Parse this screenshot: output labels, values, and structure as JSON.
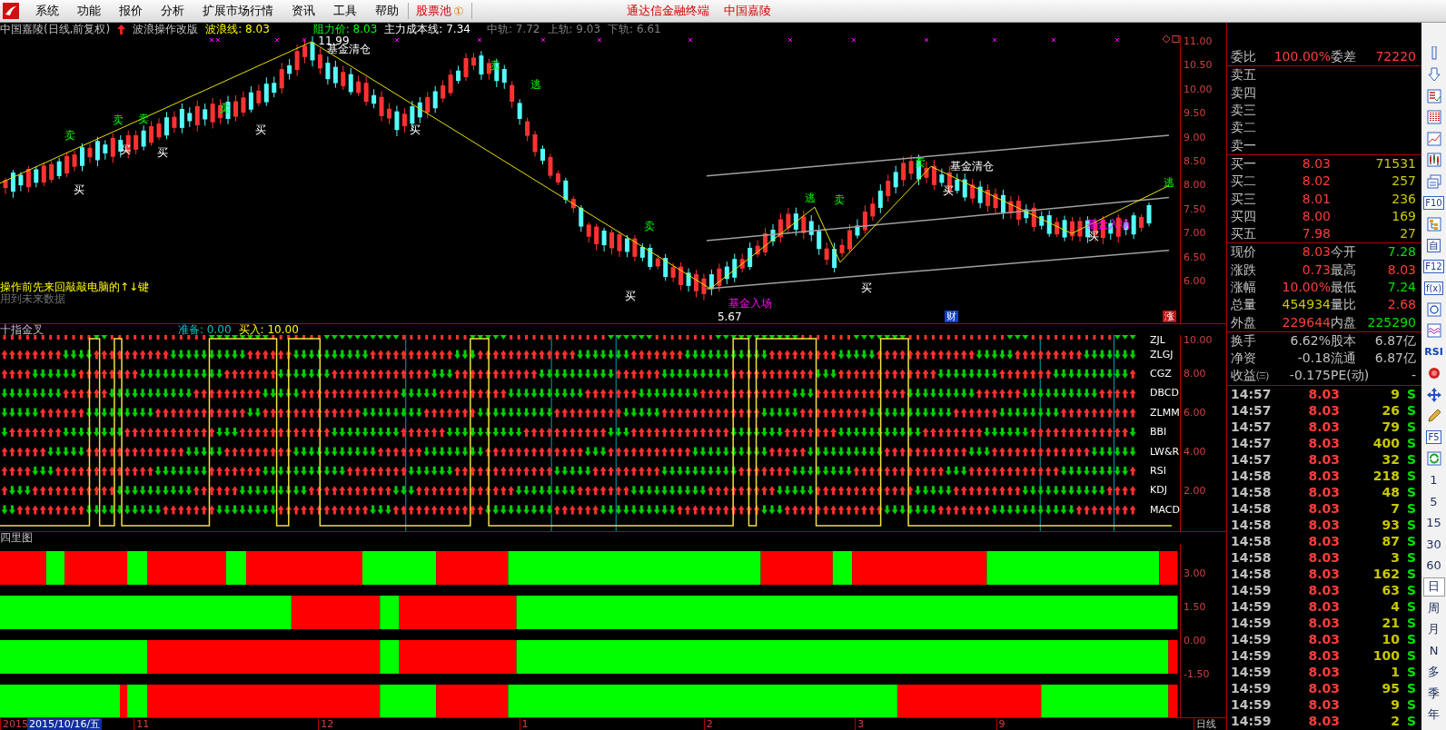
{
  "menu_bar": {
    "items": [
      "系统",
      "功能",
      "报价",
      "分析",
      "扩展市场行情",
      "资讯",
      "工具",
      "帮助"
    ],
    "pool": {
      "label": "股票池",
      "badge": "①"
    },
    "title": "通达信金融终端",
    "stock": "中国嘉陵"
  },
  "price_chart": {
    "title": "中国嘉陵(日线,前复权)",
    "indicator": "波浪操作改版",
    "readings": [
      {
        "kind": "wave",
        "text": "波浪线: 8.03"
      },
      {
        "kind": "resist",
        "text": "阻力价: 8.03"
      },
      {
        "kind": "cost",
        "text": "主力成本线: 7.34"
      },
      {
        "kind": "band",
        "text": "中轨: 7.72"
      },
      {
        "kind": "band",
        "text": "上轨: 9.03"
      },
      {
        "kind": "band",
        "text": "下轨: 6.61"
      }
    ],
    "axis": [
      "11.00",
      "10.50",
      "10.00",
      "9.50",
      "9.00",
      "8.50",
      "8.00",
      "7.50",
      "7.00",
      "6.50",
      "6.00"
    ],
    "signals": [
      {
        "kind": "buy",
        "text": "买"
      },
      {
        "kind": "sell",
        "text": "卖"
      },
      {
        "kind": "buy",
        "text": "买"
      },
      {
        "kind": "sell",
        "text": "卖"
      },
      {
        "kind": "sell",
        "text": "卖"
      },
      {
        "kind": "buy",
        "text": "买"
      },
      {
        "kind": "sell",
        "text": "卖"
      },
      {
        "kind": "buy",
        "text": "买"
      },
      {
        "kind": "price",
        "text": "11.99"
      },
      {
        "kind": "fund-out",
        "text": "基金清仓"
      },
      {
        "kind": "buy",
        "text": "买"
      },
      {
        "kind": "sell",
        "text": "卖"
      },
      {
        "kind": "escape",
        "text": "逃"
      },
      {
        "kind": "sell",
        "text": "卖"
      },
      {
        "kind": "buy",
        "text": "买"
      },
      {
        "kind": "fund-in",
        "text": "基金入场"
      },
      {
        "kind": "price",
        "text": "5.67"
      },
      {
        "kind": "escape",
        "text": "逃"
      },
      {
        "kind": "sell",
        "text": "卖"
      },
      {
        "kind": "buy",
        "text": "买"
      },
      {
        "kind": "sell",
        "text": "卖"
      },
      {
        "kind": "fund-out",
        "text": "基金清仓"
      },
      {
        "kind": "buy",
        "text": "买"
      },
      {
        "kind": "fund-in",
        "text": "基金入场"
      },
      {
        "kind": "buy",
        "text": "买"
      },
      {
        "kind": "escape",
        "text": "逃"
      }
    ],
    "notes": [
      {
        "kind": "hint",
        "text": "操作前先来回敲敲电脑的↑↓键"
      },
      {
        "kind": "warning",
        "text": "用到未来数据"
      }
    ],
    "events": [
      {
        "kind": "finance",
        "text": "财"
      },
      {
        "kind": "limit-up",
        "text": "涨"
      }
    ]
  },
  "indicator_panel": {
    "title": "十指金叉",
    "readings": [
      {
        "kind": "ready",
        "text": "准备: 0.00"
      },
      {
        "kind": "buy",
        "text": "买入: 10.00"
      }
    ],
    "lines": [
      "ZJL",
      "ZLGJ",
      "CGZ",
      "DBCD",
      "ZLMM",
      "BBI",
      "LW&R",
      "RSI",
      "KDJ",
      "MACD"
    ],
    "axis": [
      "10.00",
      "8.00",
      "6.00",
      "4.00",
      "2.00"
    ]
  },
  "bar_panel": {
    "title": "四里图",
    "axis": [
      "3.00",
      "1.50",
      "0.00",
      "-1.50"
    ]
  },
  "time_axis": {
    "labels": [
      "2015",
      "11",
      "12",
      "1",
      "2",
      "3",
      "9"
    ],
    "cursor": "2015/10/16/五",
    "period": "日线"
  },
  "quote": {
    "ratio": {
      "label": "委比",
      "value": "100.00%",
      "diff_label": "委差",
      "diff": "72220"
    },
    "asks": [
      "卖五",
      "卖四",
      "卖三",
      "卖二",
      "卖一"
    ],
    "bids": [
      {
        "label": "买一",
        "price": "8.03",
        "volume": "71531"
      },
      {
        "label": "买二",
        "price": "8.02",
        "volume": "257"
      },
      {
        "label": "买三",
        "price": "8.01",
        "volume": "236"
      },
      {
        "label": "买四",
        "price": "8.00",
        "volume": "169"
      },
      {
        "label": "买五",
        "price": "7.98",
        "volume": "27"
      }
    ],
    "stats": [
      {
        "label": "现价",
        "value": "8.03",
        "color": "#ff3c3c"
      },
      {
        "label": "今开",
        "value": "7.28",
        "color": "#00e000"
      },
      {
        "label": "涨跌",
        "value": "0.73",
        "color": "#ff3c3c"
      },
      {
        "label": "最高",
        "value": "8.03",
        "color": "#ff3c3c"
      },
      {
        "label": "涨幅",
        "value": "10.00%",
        "color": "#ff3c3c"
      },
      {
        "label": "最低",
        "value": "7.24",
        "color": "#00e000"
      },
      {
        "label": "总量",
        "value": "454934",
        "color": "#c8c800"
      },
      {
        "label": "量比",
        "value": "2.68",
        "color": "#ff3c3c"
      },
      {
        "label": "外盘",
        "value": "229644",
        "color": "#ff3c3c"
      },
      {
        "label": "内盘",
        "value": "225290",
        "color": "#00e000"
      }
    ],
    "info": [
      {
        "label": "换手",
        "value": "6.62%"
      },
      {
        "label": "股本",
        "value": "6.87亿"
      },
      {
        "label": "净资",
        "value": "-0.18"
      },
      {
        "label": "流通",
        "value": "6.87亿"
      },
      {
        "label": "收益㈢",
        "value": "-0.175"
      },
      {
        "label": "PE(动)",
        "value": "-"
      }
    ],
    "ticks": [
      {
        "time": "14:57",
        "price": "8.03",
        "volume": "9",
        "side": "S"
      },
      {
        "time": "14:57",
        "price": "8.03",
        "volume": "26",
        "side": "S"
      },
      {
        "time": "14:57",
        "price": "8.03",
        "volume": "79",
        "side": "S"
      },
      {
        "time": "14:57",
        "price": "8.03",
        "volume": "400",
        "side": "S"
      },
      {
        "time": "14:57",
        "price": "8.03",
        "volume": "32",
        "side": "S"
      },
      {
        "time": "14:58",
        "price": "8.03",
        "volume": "218",
        "side": "S"
      },
      {
        "time": "14:58",
        "price": "8.03",
        "volume": "48",
        "side": "S"
      },
      {
        "time": "14:58",
        "price": "8.03",
        "volume": "7",
        "side": "S"
      },
      {
        "time": "14:58",
        "price": "8.03",
        "volume": "93",
        "side": "S"
      },
      {
        "time": "14:58",
        "price": "8.03",
        "volume": "87",
        "side": "S"
      },
      {
        "time": "14:58",
        "price": "8.03",
        "volume": "3",
        "side": "S"
      },
      {
        "time": "14:58",
        "price": "8.03",
        "volume": "162",
        "side": "S"
      },
      {
        "time": "14:59",
        "price": "8.03",
        "volume": "63",
        "side": "S"
      },
      {
        "time": "14:59",
        "price": "8.03",
        "volume": "4",
        "side": "S"
      },
      {
        "time": "14:59",
        "price": "8.03",
        "volume": "21",
        "side": "S"
      },
      {
        "time": "14:59",
        "price": "8.03",
        "volume": "10",
        "side": "S"
      },
      {
        "time": "14:59",
        "price": "8.03",
        "volume": "100",
        "side": "S"
      },
      {
        "time": "14:59",
        "price": "8.03",
        "volume": "1",
        "side": "S"
      },
      {
        "time": "14:59",
        "price": "8.03",
        "volume": "95",
        "side": "S"
      },
      {
        "time": "14:59",
        "price": "8.03",
        "volume": "9",
        "side": "S"
      },
      {
        "time": "14:59",
        "price": "8.03",
        "volume": "2",
        "side": "S"
      }
    ]
  },
  "toolbar": {
    "labels": [
      "F10",
      "自",
      "F12",
      "f(x)",
      "RSI",
      "F5"
    ],
    "periods": [
      {
        "label": "1",
        "selected": false
      },
      {
        "label": "5",
        "selected": false
      },
      {
        "label": "15",
        "selected": false
      },
      {
        "label": "30",
        "selected": false
      },
      {
        "label": "60",
        "selected": false
      },
      {
        "label": "日",
        "selected": true
      },
      {
        "label": "周",
        "selected": false
      },
      {
        "label": "月",
        "selected": false
      },
      {
        "label": "N",
        "selected": false
      },
      {
        "label": "多",
        "selected": false
      },
      {
        "label": "季",
        "selected": false
      },
      {
        "label": "年",
        "selected": false
      }
    ]
  }
}
